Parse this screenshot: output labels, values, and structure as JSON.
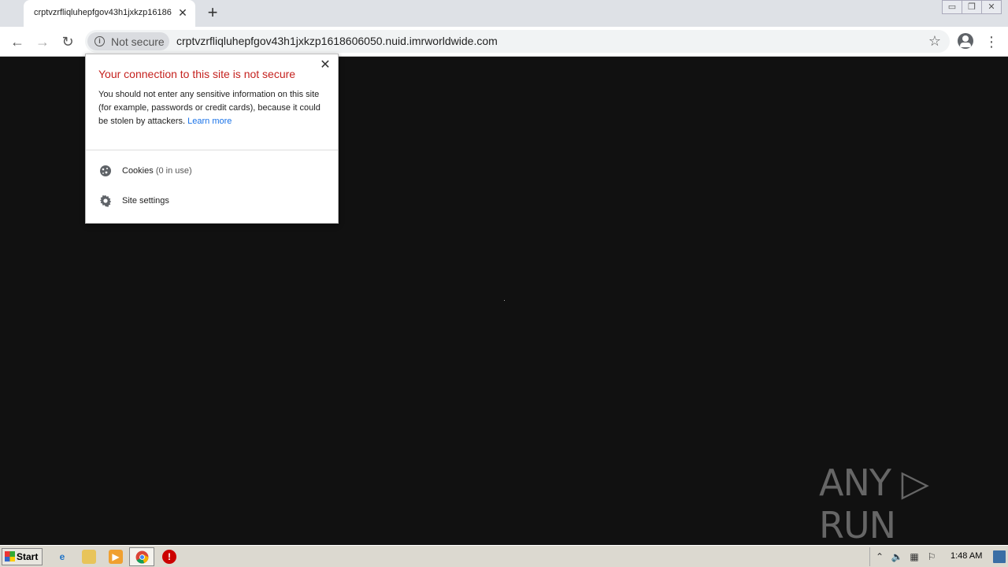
{
  "browser": {
    "tab_title": "crptvzrfliqluhepfgov43h1jxkzp16186",
    "tab_close": "✕",
    "new_tab": "+",
    "window_controls": [
      "▭",
      "❐",
      "✕"
    ]
  },
  "toolbar": {
    "back": "←",
    "forward": "→",
    "reload": "↻",
    "security_chip": "Not secure",
    "url": "crptvzrfliqluhepfgov43h1jxkzp1618606050.nuid.imrworldwide.com",
    "bookmark": "☆",
    "menu": "⋮"
  },
  "site_info_popup": {
    "close": "✕",
    "title": "Your connection to this site is not secure",
    "body": "You should not enter any sensitive information on this site (for example, passwords or credit cards), because it could be stolen by attackers.",
    "learn_more": "Learn more",
    "cookies_label": "Cookies",
    "cookies_status": "(0 in use)",
    "site_settings_label": "Site settings"
  },
  "watermark": {
    "text": "ANY ▷ RUN"
  },
  "taskbar": {
    "start_label": "Start",
    "clock": "1:48 AM"
  },
  "icons": {
    "info": "info-icon",
    "cookie": "cookie-icon",
    "gear": "gear-icon"
  }
}
